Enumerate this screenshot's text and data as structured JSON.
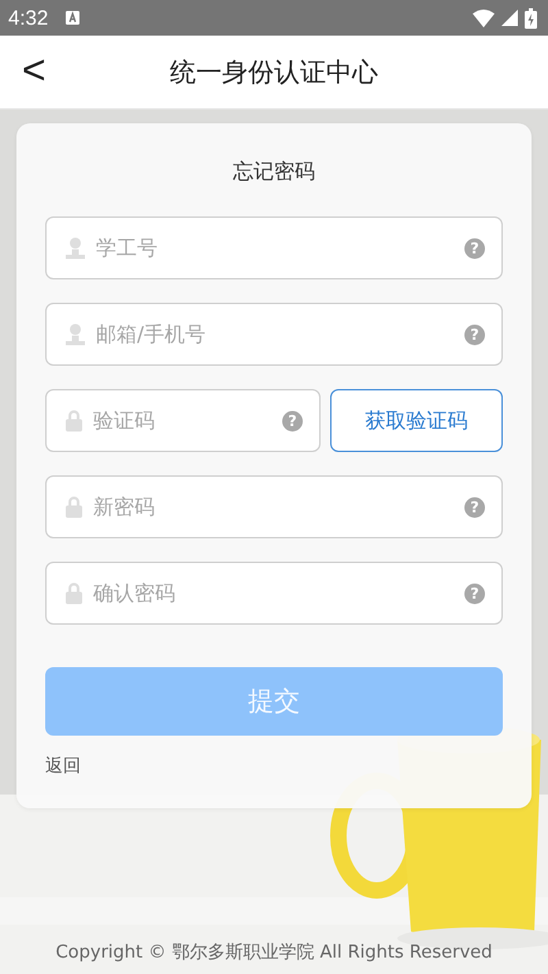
{
  "status_bar": {
    "time": "4:32"
  },
  "header": {
    "back": "<",
    "title": "统一身份认证中心"
  },
  "form": {
    "title": "忘记密码",
    "fields": [
      {
        "kind": "user",
        "placeholder": "学工号",
        "help": "?"
      },
      {
        "kind": "user",
        "placeholder": "邮箱/手机号",
        "help": "?"
      },
      {
        "kind": "code",
        "placeholder": "验证码",
        "help": "?",
        "button": "获取验证码"
      },
      {
        "kind": "lock",
        "placeholder": "新密码",
        "help": "?"
      },
      {
        "kind": "lock",
        "placeholder": "确认密码",
        "help": "?"
      }
    ],
    "submit": {
      "label": "提交",
      "disabled": true
    },
    "back_link": "返回"
  },
  "footer": {
    "copyright": "Copyright © 鄂尔多斯职业学院 All Rights Reserved"
  }
}
